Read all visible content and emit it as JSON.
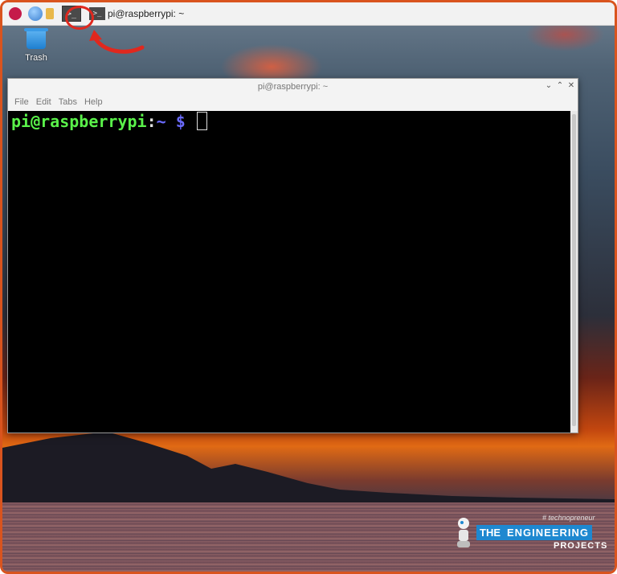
{
  "taskbar": {
    "icons": [
      "raspberry-menu-icon",
      "web-browser-icon",
      "file-manager-icon",
      "terminal-launcher-icon"
    ],
    "terminal_launcher_glyph": ">_",
    "task_glyph": ">_",
    "task_label": "pi@raspberrypi: ~"
  },
  "desktop": {
    "trash_label": "Trash"
  },
  "window": {
    "title": "pi@raspberrypi: ~",
    "minimize": "⌄",
    "maximize": "⌃",
    "close": "✕",
    "menu": [
      "File",
      "Edit",
      "Tabs",
      "Help"
    ]
  },
  "terminal": {
    "user_host": "pi@raspberrypi",
    "colon": ":",
    "path_prompt": "~ $ "
  },
  "watermark": {
    "tag": "# technopreneur",
    "the": "THE",
    "engineering": "ENGINEERING",
    "projects": "PROJECTS"
  },
  "colors": {
    "highlight": "#e0281e",
    "prompt_user": "#5af24a",
    "prompt_path": "#6b6bff",
    "frame": "#d9541e"
  }
}
